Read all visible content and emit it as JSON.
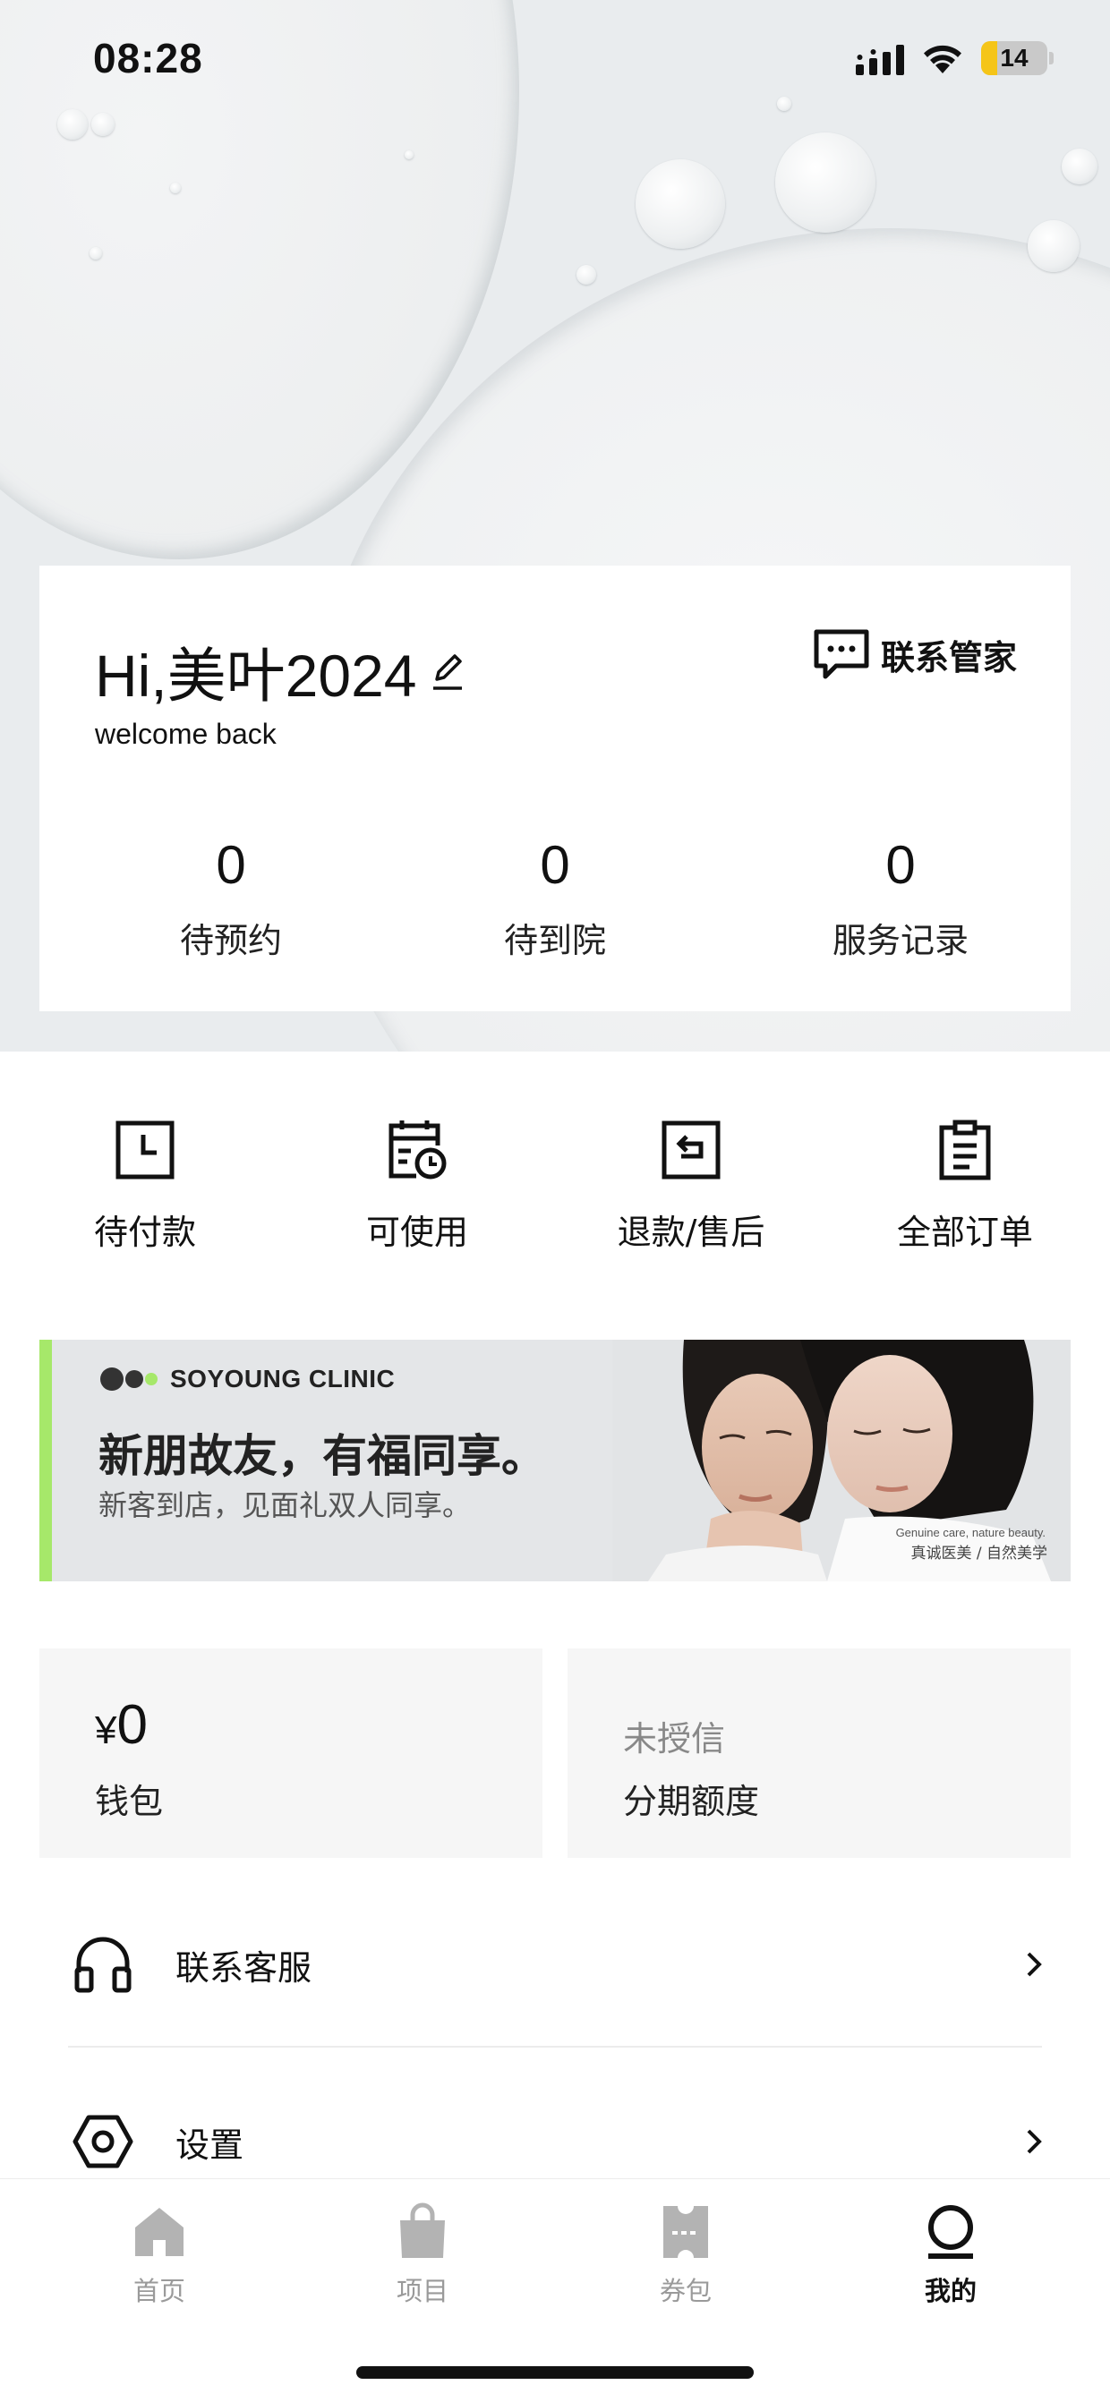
{
  "status_bar": {
    "time": "08:28",
    "battery": "14",
    "icons": [
      "signal-icon",
      "wifi-icon",
      "battery-icon"
    ]
  },
  "profile": {
    "greeting": "Hi,美叶2024",
    "welcome": "welcome back",
    "contact_label": "联系管家",
    "stats": [
      {
        "value": "0",
        "label": "待预约"
      },
      {
        "value": "0",
        "label": "待到院"
      },
      {
        "value": "0",
        "label": "服务记录"
      }
    ]
  },
  "orders": [
    {
      "label": "待付款",
      "icon": "clock-icon"
    },
    {
      "label": "可使用",
      "icon": "calendar-clock-icon"
    },
    {
      "label": "退款/售后",
      "icon": "return-icon"
    },
    {
      "label": "全部订单",
      "icon": "clipboard-icon"
    }
  ],
  "banner": {
    "brand": "SOYOUNG CLINIC",
    "headline": "新朋故友，有福同享。",
    "subtitle": "新客到店，见面礼双人同享。",
    "tag_en": "Genuine care, nature beauty.",
    "tag_cn": "真诚医美 / 自然美学",
    "accent_color": "#a6e86a"
  },
  "wallet": {
    "currency": "¥",
    "amount": "0",
    "label": "钱包"
  },
  "credit": {
    "status": "未授信",
    "label": "分期额度"
  },
  "menu": [
    {
      "label": "联系客服",
      "icon": "headset-icon"
    },
    {
      "label": "设置",
      "icon": "settings-icon"
    }
  ],
  "tabbar": [
    {
      "label": "首页",
      "icon": "home-icon",
      "active": false
    },
    {
      "label": "项目",
      "icon": "bag-icon",
      "active": false
    },
    {
      "label": "券包",
      "icon": "coupon-icon",
      "active": false
    },
    {
      "label": "我的",
      "icon": "profile-icon",
      "active": true
    }
  ]
}
